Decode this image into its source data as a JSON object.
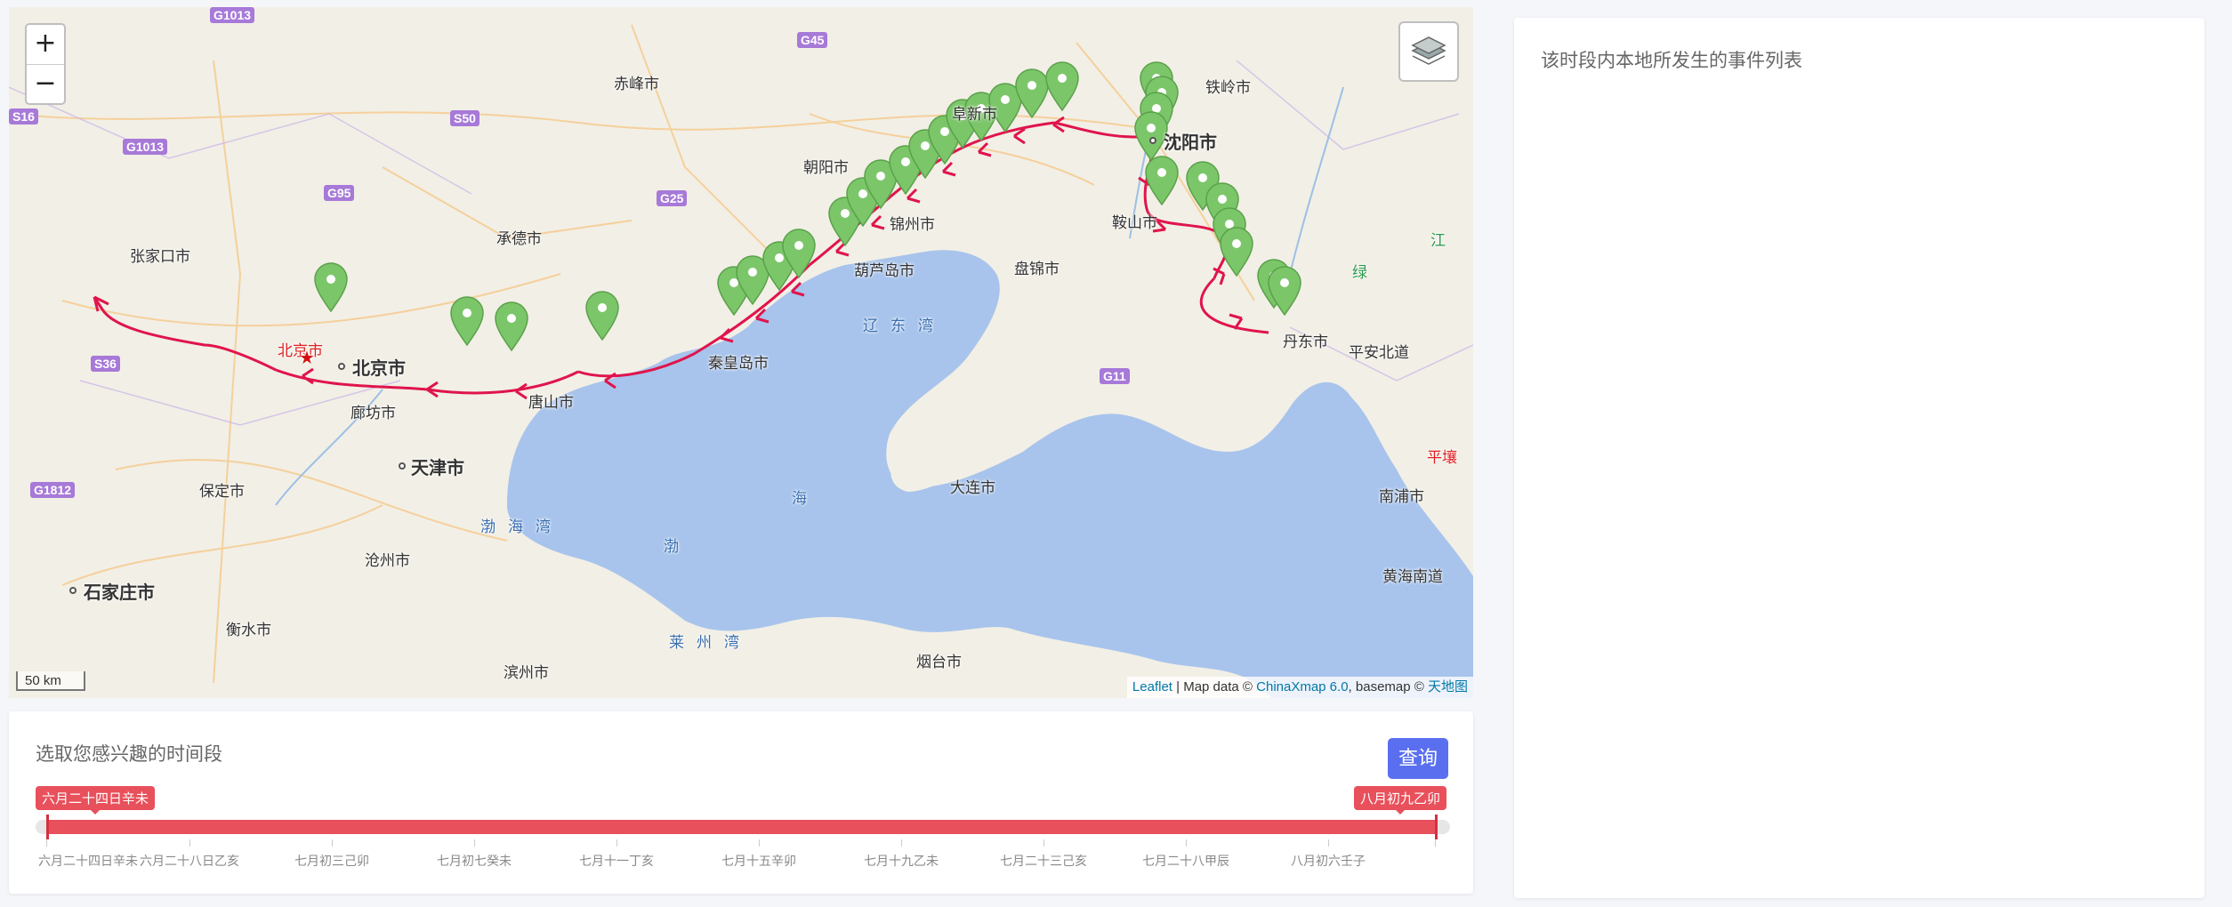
{
  "map": {
    "zoom_in": "+",
    "zoom_out": "−",
    "layers_icon": "layers-icon",
    "scale": "50 km",
    "attribution": {
      "leaflet": "Leaflet",
      "sep1": " | Map data © ",
      "chinaxmap": "ChinaXmap 6.0",
      "sep2": ", basemap © ",
      "tianditu": "天地图"
    },
    "colors": {
      "route": "#e0144c",
      "marker": "#7cc66a",
      "sea": "#a8c4ec",
      "land": "#f2efe6"
    },
    "labels": [
      {
        "text": "赤峰市",
        "kind": "normal"
      },
      {
        "text": "铁岭市",
        "kind": "normal"
      },
      {
        "text": "沈阳市",
        "kind": "city"
      },
      {
        "text": "阜新市",
        "kind": "normal"
      },
      {
        "text": "朝阳市",
        "kind": "normal"
      },
      {
        "text": "承德市",
        "kind": "normal"
      },
      {
        "text": "张家口市",
        "kind": "normal"
      },
      {
        "text": "锦州市",
        "kind": "normal"
      },
      {
        "text": "葫芦岛市",
        "kind": "normal"
      },
      {
        "text": "盘锦市",
        "kind": "normal"
      },
      {
        "text": "鞍山市",
        "kind": "normal"
      },
      {
        "text": "丹东市",
        "kind": "normal"
      },
      {
        "text": "平安北道",
        "kind": "normal"
      },
      {
        "text": "北京市",
        "kind": "red"
      },
      {
        "text": "北京市",
        "kind": "city"
      },
      {
        "text": "秦皇岛市",
        "kind": "normal"
      },
      {
        "text": "唐山市",
        "kind": "normal"
      },
      {
        "text": "廊坊市",
        "kind": "normal"
      },
      {
        "text": "天津市",
        "kind": "city"
      },
      {
        "text": "保定市",
        "kind": "normal"
      },
      {
        "text": "沧州市",
        "kind": "normal"
      },
      {
        "text": "石家庄市",
        "kind": "city"
      },
      {
        "text": "衡水市",
        "kind": "normal"
      },
      {
        "text": "滨州市",
        "kind": "normal"
      },
      {
        "text": "烟台市",
        "kind": "normal"
      },
      {
        "text": "大连市",
        "kind": "normal"
      },
      {
        "text": "南浦市",
        "kind": "normal"
      },
      {
        "text": "黄海南道",
        "kind": "normal"
      },
      {
        "text": "平壤",
        "kind": "red"
      },
      {
        "text": "辽东湾",
        "kind": "sea"
      },
      {
        "text": "渤海湾",
        "kind": "sea"
      },
      {
        "text": "莱州湾",
        "kind": "sea"
      },
      {
        "text": "海",
        "kind": "sea"
      },
      {
        "text": "渤",
        "kind": "sea"
      },
      {
        "text": "绿",
        "kind": "green"
      },
      {
        "text": "江",
        "kind": "green"
      }
    ],
    "shields": [
      "G1013",
      "G45",
      "S16",
      "S50",
      "G1013",
      "G95",
      "G25",
      "S36",
      "G11",
      "G1812"
    ]
  },
  "time_panel": {
    "title": "选取您感兴趣的时间段",
    "query_button": "查询",
    "start_tag": "六月二十四日辛未",
    "end_tag": "八月初九乙卯",
    "ticks": [
      "六月二十四日辛未",
      "六月二十八日乙亥",
      "七月初三己卯",
      "七月初七癸未",
      "七月十一丁亥",
      "七月十五辛卯",
      "七月十九乙未",
      "七月二十三己亥",
      "七月二十八甲辰",
      "八月初六壬子"
    ]
  },
  "event_panel": {
    "title": "该时段内本地所发生的事件列表"
  }
}
